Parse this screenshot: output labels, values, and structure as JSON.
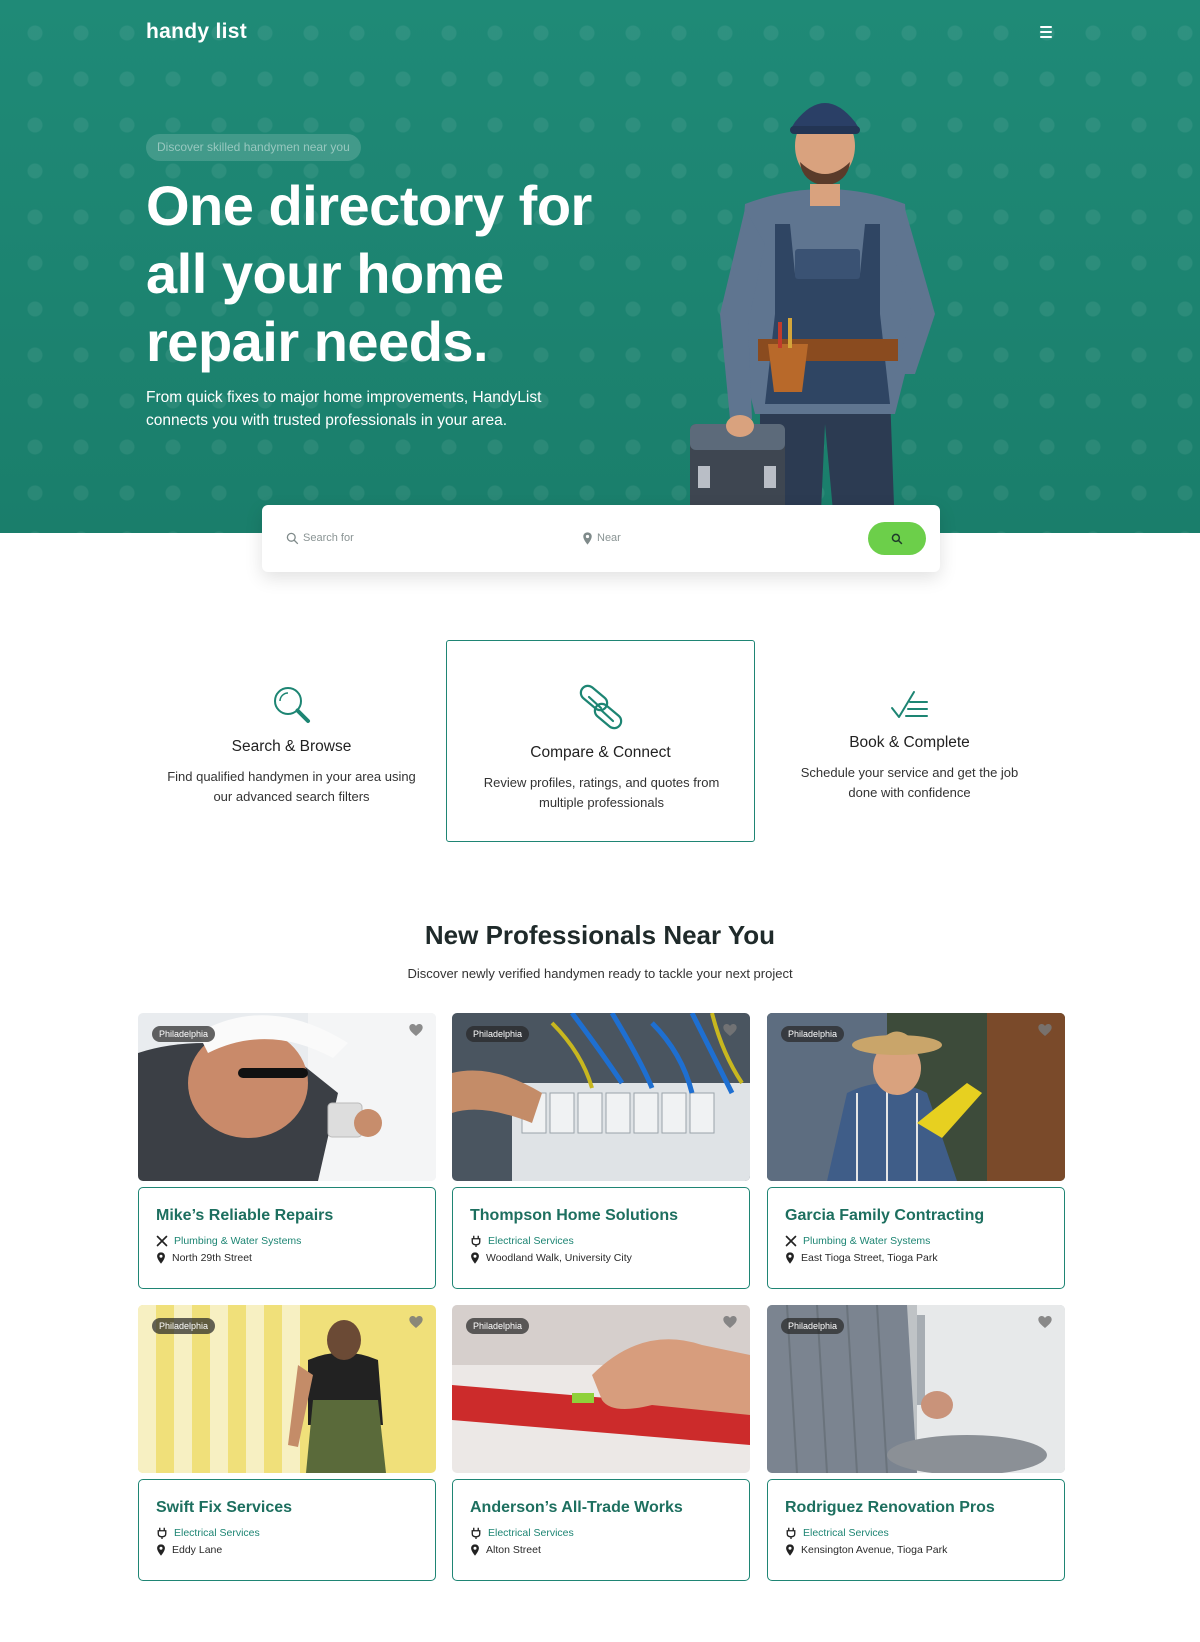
{
  "brand": {
    "logo_text": "handy list",
    "logo_icon": "tools-icon"
  },
  "header": {
    "menu_icon": "hamburger-menu-icon"
  },
  "hero": {
    "pill": "Discover skilled handymen near you",
    "title": "One directory for all your home repair needs.",
    "subtitle": "From quick fixes to major home improvements, HandyList connects you with trusted professionals in your area."
  },
  "search": {
    "search_placeholder": "Search for",
    "near_placeholder": "Near",
    "button_icon": "search-icon"
  },
  "features": [
    {
      "title": "Search & Browse",
      "description": "Find qualified handymen in your area using our advanced search filters",
      "icon": "magnifier-icon"
    },
    {
      "title": "Compare & Connect",
      "description": "Review profiles, ratings, and quotes from multiple professionals",
      "icon": "paperclip-icon"
    },
    {
      "title": "Book & Complete",
      "description": "Schedule your service and get the job done with confidence",
      "icon": "checklist-icon"
    }
  ],
  "new_professionals": {
    "title": "New Professionals Near You",
    "subtitle": "Discover newly verified handymen ready to tackle your next project",
    "cards": [
      {
        "city": "Philadelphia",
        "name": "Mike’s Reliable Repairs",
        "category": "Plumbing & Water Systems",
        "location": "North 29th Street"
      },
      {
        "city": "Philadelphia",
        "name": "Thompson Home Solutions",
        "category": "Electrical Services",
        "location": "Woodland Walk, University City"
      },
      {
        "city": "Philadelphia",
        "name": "Garcia Family Contracting",
        "category": "Plumbing & Water Systems",
        "location": "East Tioga Street, Tioga Park"
      },
      {
        "city": "Philadelphia",
        "name": "Swift Fix Services",
        "category": "Electrical Services",
        "location": "Eddy Lane"
      },
      {
        "city": "Philadelphia",
        "name": "Anderson’s All-Trade Works",
        "category": "Electrical Services",
        "location": "Alton Street"
      },
      {
        "city": "Philadelphia",
        "name": "Rodriguez Renovation Pros",
        "category": "Electrical Services",
        "location": "Kensington Avenue, Tioga Park"
      }
    ]
  },
  "colors": {
    "primary": "#1d8573",
    "accent": "#6ccf4a",
    "card_title": "#1d6f5f"
  }
}
